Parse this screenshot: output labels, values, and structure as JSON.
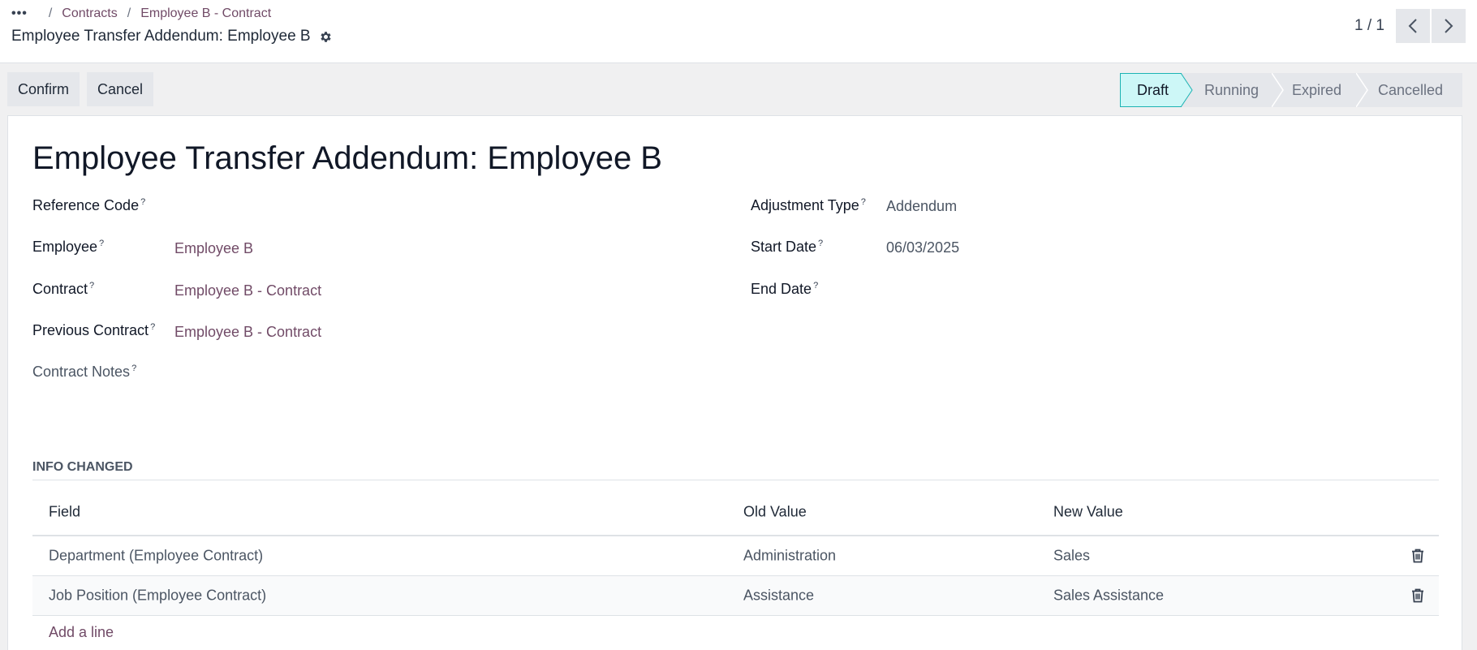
{
  "breadcrumb": {
    "overflow_label": "•••",
    "items": [
      "Contracts",
      "Employee B - Contract"
    ]
  },
  "record": {
    "title": "Employee Transfer Addendum: Employee B"
  },
  "pager": {
    "counter": "1 / 1"
  },
  "actions": {
    "confirm_label": "Confirm",
    "cancel_label": "Cancel"
  },
  "statusbar": {
    "stages": [
      "Draft",
      "Running",
      "Expired",
      "Cancelled"
    ],
    "active": "Draft"
  },
  "form": {
    "title": "Employee Transfer Addendum: Employee B",
    "help_marker": "?",
    "left_fields": [
      {
        "label": "Reference Code",
        "value": ""
      },
      {
        "label": "Employee",
        "value": "Employee B"
      },
      {
        "label": "Contract",
        "value": "Employee B - Contract"
      },
      {
        "label": "Previous Contract",
        "value": "Employee B - Contract"
      },
      {
        "label": "Contract Notes",
        "value": ""
      }
    ],
    "right_fields": [
      {
        "label": "Adjustment Type",
        "value": "Addendum"
      },
      {
        "label": "Start Date",
        "value": "06/03/2025"
      },
      {
        "label": "End Date",
        "value": ""
      }
    ]
  },
  "info_changed": {
    "section_title": "INFO CHANGED",
    "columns": [
      "Field",
      "Old Value",
      "New Value"
    ],
    "rows": [
      {
        "field": "Department (Employee Contract)",
        "old": "Administration",
        "new": "Sales"
      },
      {
        "field": "Job Position (Employee Contract)",
        "old": "Assistance",
        "new": "Sales Assistance"
      }
    ],
    "add_line_label": "Add a line"
  },
  "colors": {
    "link": "#714b67",
    "active_stage_bg": "#cdf7f7",
    "active_stage_border": "#1cb3b3"
  }
}
